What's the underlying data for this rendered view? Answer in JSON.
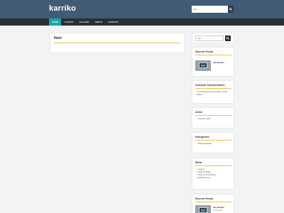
{
  "site": {
    "title": "karriko"
  },
  "header_search": {
    "placeholder": "Sök ..."
  },
  "nav": {
    "items": [
      "Home",
      "Latests",
      "Gallery",
      "About",
      "Contact"
    ],
    "active_index": 0
  },
  "main": {
    "title": "Hem"
  },
  "sidebar": {
    "search": {
      "placeholder": "Sök ..."
    },
    "recent_posts": {
      "title": "Recent Posts",
      "post_title": "Hej världen!"
    },
    "recent_comments": {
      "title": "Senaste kommentarer",
      "items": [
        "En WordPress-kommentator om Hej världen!"
      ]
    },
    "archive": {
      "title": "Arkiv",
      "items": [
        "november 2021"
      ]
    },
    "categories": {
      "title": "Kategorier",
      "items": [
        "Okategoriserade"
      ]
    },
    "meta": {
      "title": "Meta",
      "items": [
        "Logga in",
        "Flöde för inlägg",
        "Flöde för kommentarer",
        "WordPress.org"
      ]
    },
    "recent_posts_2": {
      "title": "Recent Posts",
      "post_title": "Hej världen!",
      "post_date": "22 november"
    }
  },
  "colors": {
    "header": "#425b74",
    "nav": "#2a2e33",
    "accent": "#16a7b3",
    "underline": "#f0c040"
  }
}
